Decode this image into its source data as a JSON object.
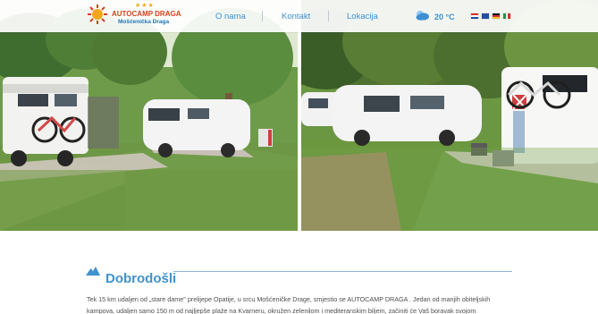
{
  "header": {
    "logo": {
      "stars": "★★★",
      "title": "AUTOCAMP DRAGA",
      "subtitle": "Mošćenička Draga"
    },
    "nav": [
      {
        "label": "O nama"
      },
      {
        "label": "Kontakt"
      },
      {
        "label": "Lokacija"
      }
    ],
    "weather": {
      "icon": "cloud-sun-icon",
      "temperature": "20 °C"
    },
    "languages": [
      {
        "icon": "flag-hr-icon"
      },
      {
        "icon": "flag-uk-icon"
      },
      {
        "icon": "flag-de-icon"
      },
      {
        "icon": "flag-it-icon"
      }
    ]
  },
  "hero": {
    "images": [
      {
        "icon": "campsite-photo-left"
      },
      {
        "icon": "campsite-photo-right"
      }
    ]
  },
  "content": {
    "section_title": "Dobrodošli",
    "paragraph_lines": [
      "Tek 15 km udaljen od „stare dame\" prelijepe Opatije, u srcu Mošćeničke Drage, smjestio se AUTOCAMP DRAGA . Jedan od manjih obiteljskih",
      "kampova, udaljen samo 150 m od najljepše plaže na Kvarneru, okružen zelenilom i mediteranskim biljem, začiniti će Vaš boravak svojom"
    ]
  },
  "colors": {
    "accent": "#3d8fd1",
    "logo_red": "#d93f1b",
    "logo_blue": "#1f74ba",
    "sun_yellow": "#f3a81b"
  }
}
